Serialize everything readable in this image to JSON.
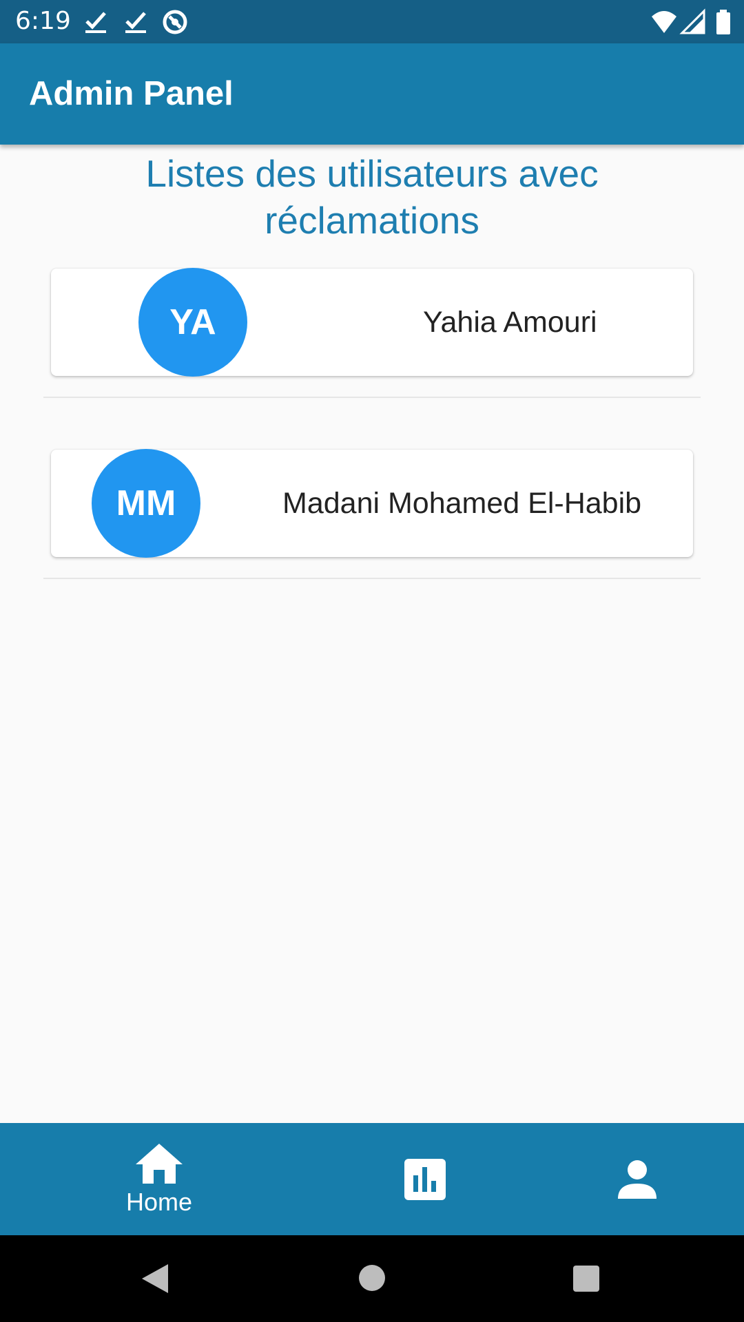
{
  "status_bar": {
    "time": "6:19",
    "icons": [
      "check-download-icon",
      "check-download-icon",
      "data-saver-icon",
      "wifi-icon",
      "cell-signal-icon",
      "battery-icon"
    ]
  },
  "app_bar": {
    "title": "Admin Panel",
    "color": "#177dab"
  },
  "page": {
    "heading_line1": "Listes des utilisateurs avec",
    "heading_line2": "réclamations",
    "heading_color": "#1e7eb0"
  },
  "users": [
    {
      "initials": "YA",
      "name": "Yahia Amouri"
    },
    {
      "initials": "MM",
      "name": "Madani Mohamed El-Habib"
    }
  ],
  "avatar_color": "#2196f0",
  "bottom_nav": {
    "items": [
      {
        "icon": "home-icon",
        "label": "Home",
        "active": true
      },
      {
        "icon": "bar-chart-icon",
        "label": "",
        "active": false
      },
      {
        "icon": "person-icon",
        "label": "",
        "active": false
      }
    ]
  },
  "system_nav": {
    "icons": [
      "back-icon",
      "home-circle-icon",
      "recents-icon"
    ]
  }
}
